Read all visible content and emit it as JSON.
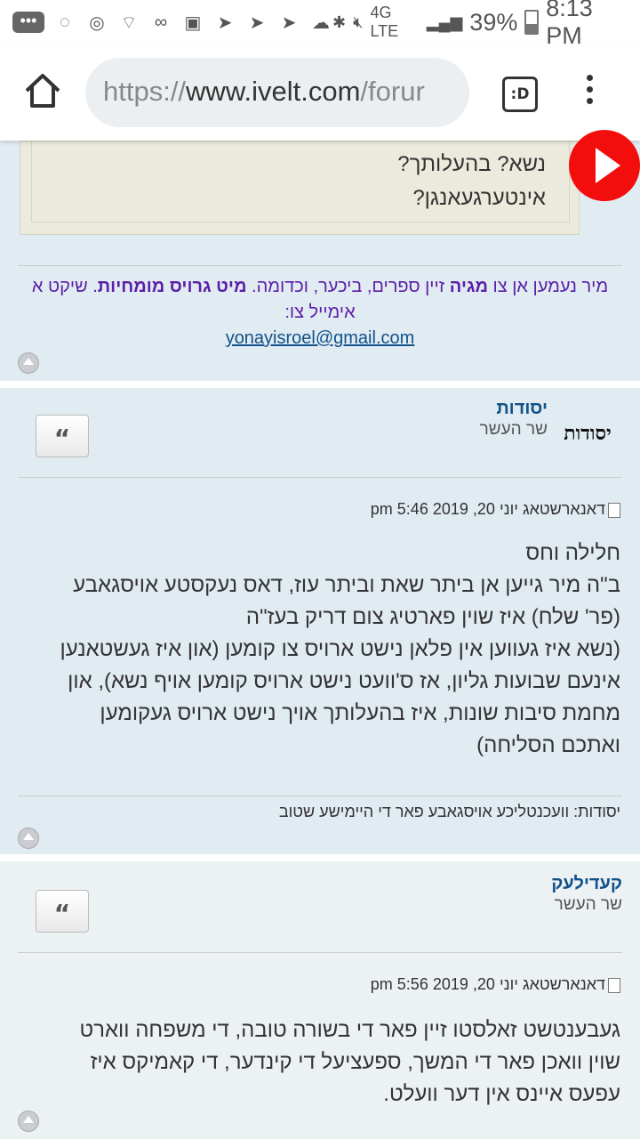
{
  "status_bar": {
    "battery_percent": "39%",
    "time": "8:13 PM",
    "network": "4G LTE"
  },
  "browser": {
    "url_scheme": "https://",
    "url_host": "www.ivelt.com",
    "url_path": "/forur",
    "tab_label": ":D"
  },
  "post1": {
    "quote_lines": [
      "נשא? בהעלותך?",
      "אינטערגעאנגן?"
    ],
    "sig_part1": "מיר נעמען אן צו ",
    "sig_bold1": "מגיה",
    "sig_part2": " זיין ספרים, ביכער, וכדומה. ",
    "sig_bold2": "מיט גרויס מומחיות",
    "sig_part3": ". שיקט א אימייל צו:",
    "sig_email": "yonayisroel@gmail.com"
  },
  "post2": {
    "author": "יסודות",
    "rank": "שר העשר",
    "avatar_text": "יסודות",
    "quote_symbol": "“",
    "date": "דאנארשטאג יוני 20, 2019 5:46 pm",
    "body_lines": [
      "חלילה וחס",
      "ב\"ה מיר גייען אן ביתר שאת וביתר עוז, דאס נעקסטע אויסגאבע",
      "(פר' שלח) איז שוין פארטיג צום דריק בעז\"ה",
      "(נשא איז געווען אין פלאן נישט ארויס צו קומען (און איז געשטאנען",
      "אינעם שבועות גליון, אז ס'וועט נישט ארויס קומען אויף נשא), און",
      "מחמת סיבות שונות, איז בהעלותך אויך נישט ארויס געקומען",
      "ואתכם הסליחה)"
    ],
    "footer": "יסודות: וועכנטליכע אויסגאבע פאר די היימישע שטוב"
  },
  "post3": {
    "author": "קעדילעק",
    "rank": "שר העשר",
    "quote_symbol": "“",
    "date": "דאנארשטאג יוני 20, 2019 5:56 pm",
    "body_lines": [
      "געבענטשט זאלסטו זיין פאר די בשורה טובה, די משפחה ווארט",
      "שוין וואכן פאר די המשך, ספעציעל די קינדער, די קאמיקס איז",
      "עפעס איינס אין דער וועלט."
    ]
  },
  "colors": {
    "post_bg": "#e1ebf2",
    "link": "#105289",
    "signature": "#5a1fa8",
    "float_button": "#f40d0d"
  }
}
